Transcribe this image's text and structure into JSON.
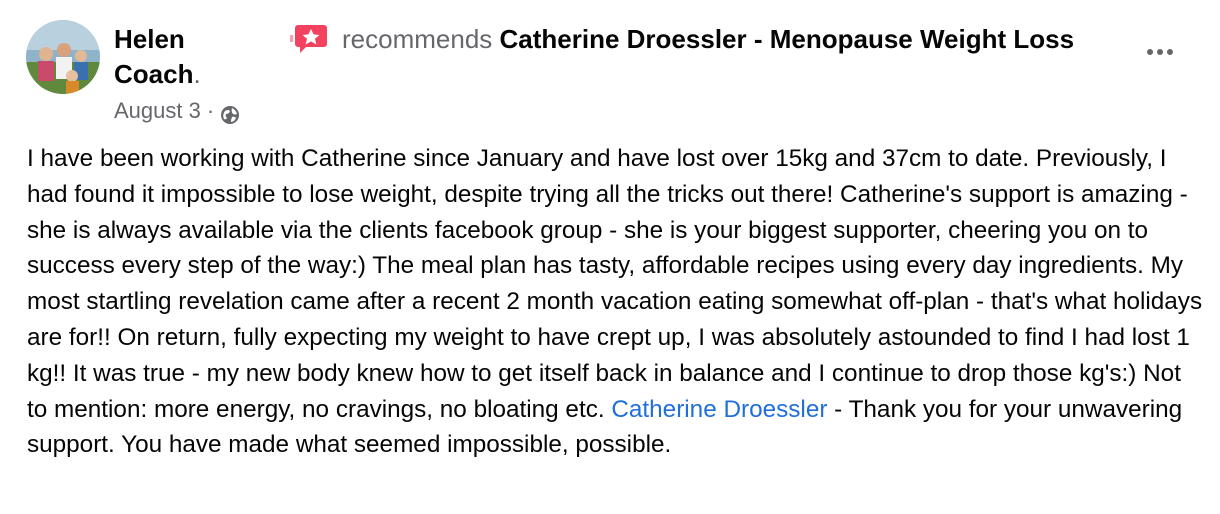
{
  "post": {
    "author": {
      "name_line1": "Helen",
      "name_line2": "Coach",
      "name_suffix": "."
    },
    "action": {
      "verb": "recommends",
      "page_name": "Catherine Droessler - Menopause Weight Loss",
      "icon": "recommend-icon"
    },
    "date": "August 3",
    "separator": "·",
    "audience_icon": "globe-icon",
    "more_icon": "more-options-icon",
    "body": {
      "part1": "I have been working with Catherine since January and have lost over 15kg and 37cm to date. Previously, I had found it impossible to lose weight, despite trying all the tricks out there! Catherine's support is amazing - she is always available via the clients facebook group - she is your biggest supporter, cheering you on to success every step of the way:) The meal plan has tasty, affordable recipes using every day ingredients. My most startling revelation came after a recent 2 month vacation eating somewhat off-plan - that's what holidays are for!! On return, fully expecting my weight to have crept up, I was absolutely astounded to find I had lost 1 kg!! It was true - my new body knew how to get itself back in balance and I continue to drop those kg's:) Not to mention: more energy, no cravings, no bloating etc. ",
      "mention": "Catherine Droessler",
      "part2": " - Thank you for your unwavering support. You have made what seemed impossible, possible."
    }
  },
  "colors": {
    "text_primary": "#050505",
    "text_secondary": "#65676b",
    "link": "#216fdb",
    "recommend_red": "#f3425f"
  }
}
